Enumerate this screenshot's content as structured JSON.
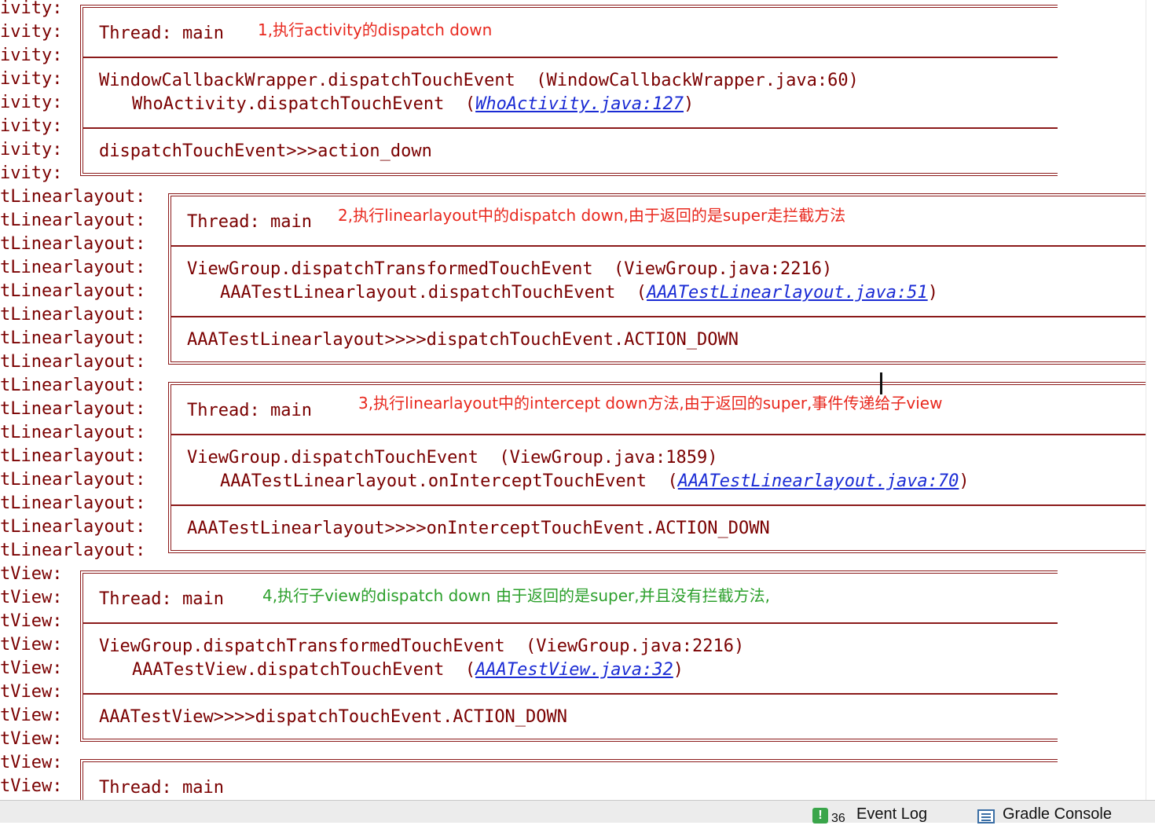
{
  "log": {
    "prefixes": [
      "ivity:",
      "ivity:",
      "ivity:",
      "ivity:",
      "ivity:",
      "ivity:",
      "ivity:",
      "ivity:",
      "tLinearlayout:",
      "tLinearlayout:",
      "tLinearlayout:",
      "tLinearlayout:",
      "tLinearlayout:",
      "tLinearlayout:",
      "tLinearlayout:",
      "tLinearlayout:",
      "tLinearlayout:",
      "tLinearlayout:",
      "tLinearlayout:",
      "tLinearlayout:",
      "tLinearlayout:",
      "tLinearlayout:",
      "tLinearlayout:",
      "tLinearlayout:",
      "tView:",
      "tView:",
      "tView:",
      "tView:",
      "tView:",
      "tView:",
      "tView:",
      "tView:",
      "tView:",
      "tView:"
    ],
    "blocks": [
      {
        "thread": "Thread: main",
        "annotation": "1,执行activity的dispatch down",
        "annotation_color": "#e8281e",
        "stack_line1": "WindowCallbackWrapper.dispatchTouchEvent  (WindowCallbackWrapper.java:60)",
        "stack_line2_method": "WhoActivity.dispatchTouchEvent  (",
        "stack_line2_link": "WhoActivity.java:127",
        "stack_line2_close": ")",
        "message": "dispatchTouchEvent>>>action_down"
      },
      {
        "thread": "Thread: main",
        "annotation": "2,执行linearlayout中的dispatch down,由于返回的是super走拦截方法",
        "annotation_color": "#e8281e",
        "stack_line1": "ViewGroup.dispatchTransformedTouchEvent  (ViewGroup.java:2216)",
        "stack_line2_method": "AAATestLinearlayout.dispatchTouchEvent  (",
        "stack_line2_link": "AAATestLinearlayout.java:51",
        "stack_line2_close": ")",
        "message": "AAATestLinearlayout>>>>dispatchTouchEvent.ACTION_DOWN"
      },
      {
        "thread": "Thread: main",
        "annotation": "3,执行linearlayout中的intercept down方法,由于返回的super,事件传递给子view",
        "annotation_color": "#e8281e",
        "stack_line1": "ViewGroup.dispatchTouchEvent  (ViewGroup.java:1859)",
        "stack_line2_method": "AAATestLinearlayout.onInterceptTouchEvent  (",
        "stack_line2_link": "AAATestLinearlayout.java:70",
        "stack_line2_close": ")",
        "message": "AAATestLinearlayout>>>>onInterceptTouchEvent.ACTION_DOWN"
      },
      {
        "thread": "Thread: main",
        "annotation": "4,执行子view的dispatch down 由于返回的是super,并且没有拦截方法,",
        "annotation_color": "#2ca02c",
        "stack_line1": "ViewGroup.dispatchTransformedTouchEvent  (ViewGroup.java:2216)",
        "stack_line2_method": "AAATestView.dispatchTouchEvent  (",
        "stack_line2_link": "AAATestView.java:32",
        "stack_line2_close": ")",
        "message": "AAATestView>>>>dispatchTouchEvent.ACTION_DOWN"
      },
      {
        "thread": "Thread: main"
      }
    ]
  },
  "statusbar": {
    "event_log_badge": "!",
    "event_log_count": "36",
    "event_log_label": "Event Log",
    "gradle_console_label": "Gradle Console"
  },
  "colors": {
    "log_text": "#7a0000",
    "frame": "#8b1a1a",
    "link": "#1a2bd4",
    "annotation_red": "#e8281e",
    "annotation_green": "#2ca02c"
  }
}
